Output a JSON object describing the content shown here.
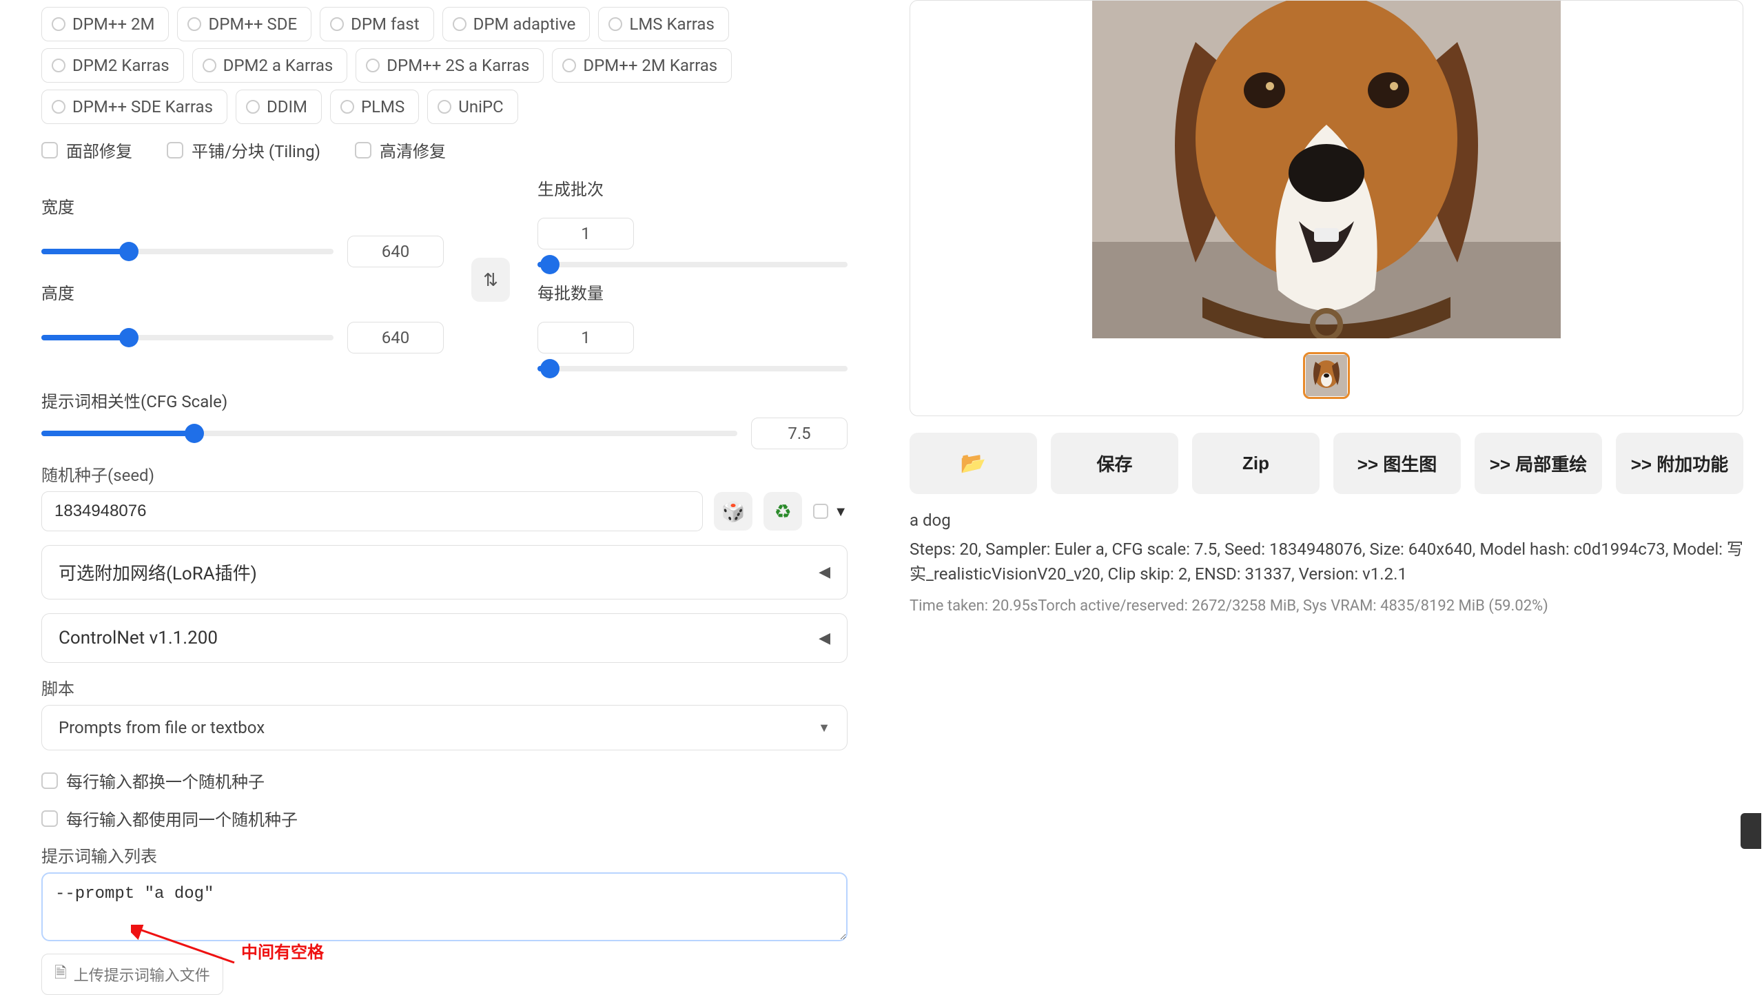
{
  "samplers": {
    "row1": [
      "DPM++ 2M",
      "DPM++ SDE",
      "DPM fast",
      "DPM adaptive",
      "LMS Karras"
    ],
    "row2": [
      "DPM2 Karras",
      "DPM2 a Karras",
      "DPM++ 2S a Karras",
      "DPM++ 2M Karras"
    ],
    "row3": [
      "DPM++ SDE Karras",
      "DDIM",
      "PLMS",
      "UniPC"
    ]
  },
  "checkboxes": {
    "face_restore": "面部修复",
    "tiling": "平铺/分块 (Tiling)",
    "highres": "高清修复"
  },
  "sliders": {
    "width_label": "宽度",
    "width_value": "640",
    "height_label": "高度",
    "height_value": "640",
    "batch_count_label": "生成批次",
    "batch_count_value": "1",
    "batch_size_label": "每批数量",
    "batch_size_value": "1",
    "cfg_label": "提示词相关性(CFG Scale)",
    "cfg_value": "7.5"
  },
  "seed": {
    "label": "随机种子(seed)",
    "value": "1834948076"
  },
  "accordions": {
    "lora": "可选附加网络(LoRA插件)",
    "controlnet": "ControlNet v1.1.200"
  },
  "script": {
    "label": "脚本",
    "selected": "Prompts from file or textbox",
    "opt_iterate_seed": "每行输入都换一个随机种子",
    "opt_same_seed": "每行输入都使用同一个随机种子",
    "prompt_list_label": "提示词输入列表",
    "prompt_list_value": "--prompt \"a dog\"",
    "upload_label": "上传提示词输入文件"
  },
  "annotation": {
    "text": "中间有空格"
  },
  "output": {
    "prompt": "a dog",
    "meta": "Steps: 20, Sampler: Euler a, CFG scale: 7.5, Seed: 1834948076, Size: 640x640, Model hash: c0d1994c73, Model: 写实_realisticVisionV20_v20, Clip skip: 2, ENSD: 31337, Version: v1.2.1",
    "time": "Time taken: 20.95sTorch active/reserved: 2672/3258 MiB, Sys VRAM: 4835/8192 MiB (59.02%)"
  },
  "buttons": {
    "folder": "📂",
    "save": "保存",
    "zip": "Zip",
    "img2img": ">> 图生图",
    "inpaint": ">> 局部重绘",
    "extras": ">> 附加功能"
  }
}
